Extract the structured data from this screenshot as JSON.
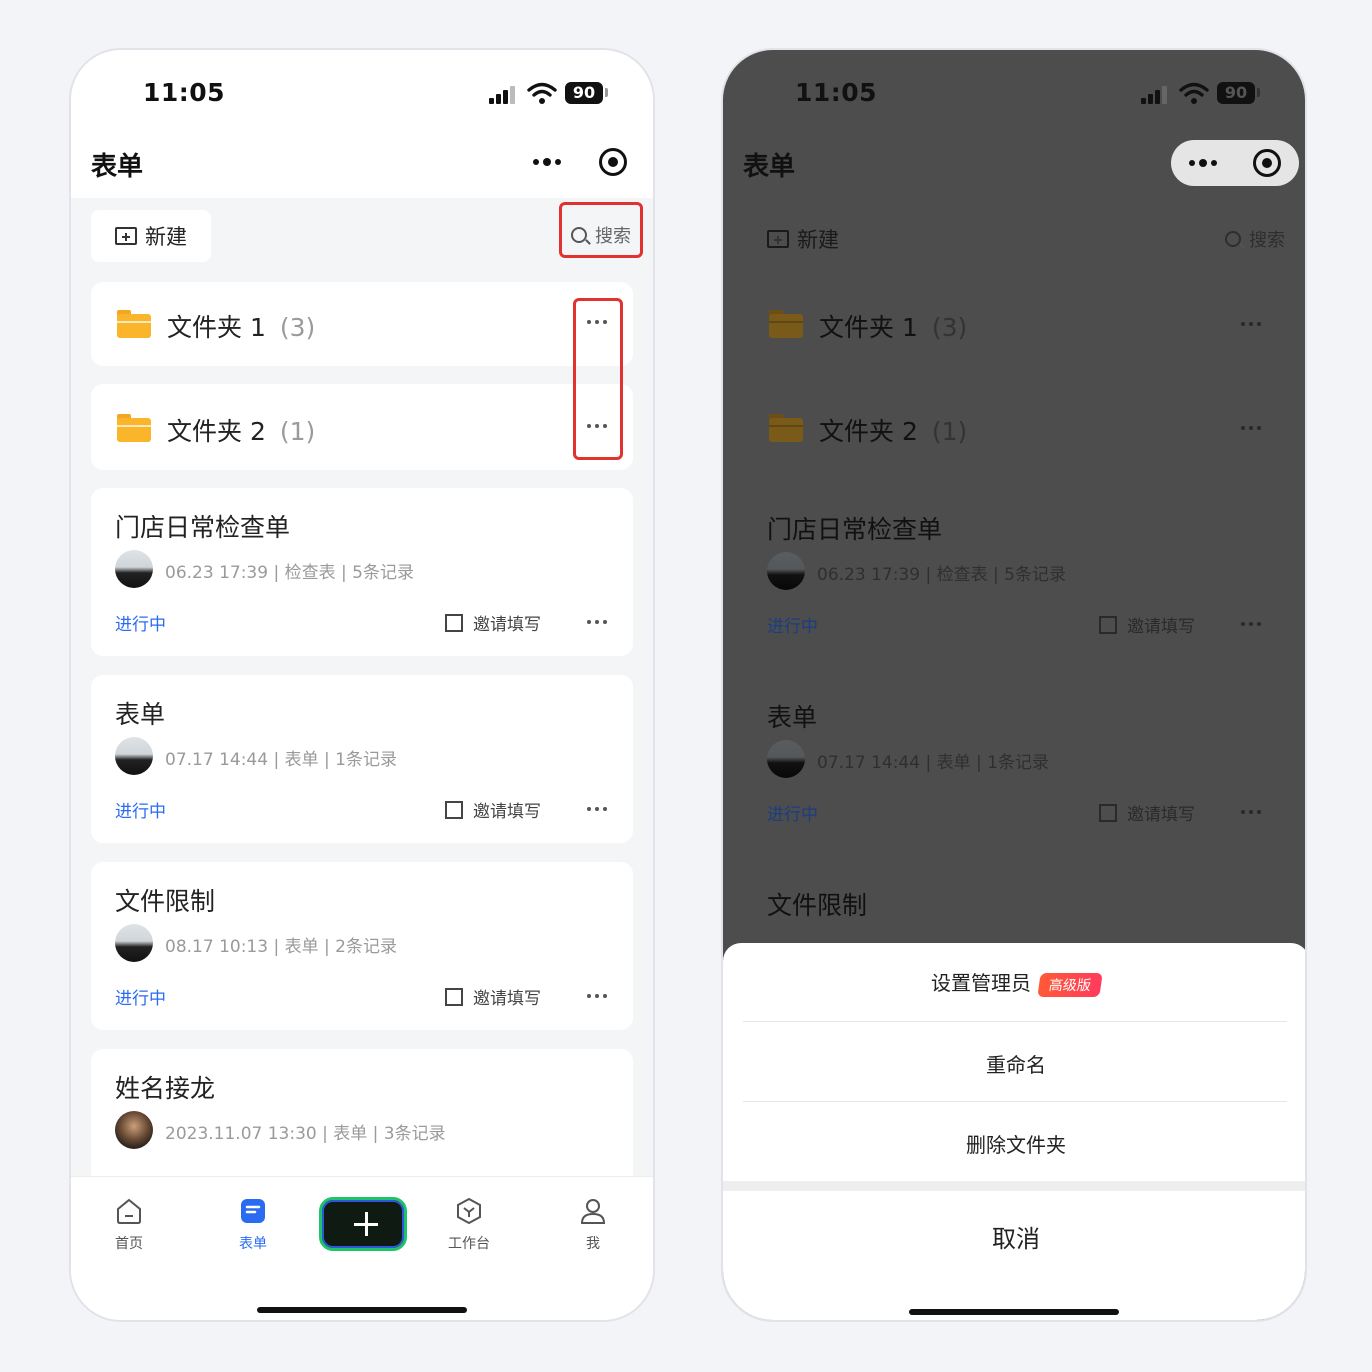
{
  "status_bar": {
    "time": "11:05",
    "battery": "90"
  },
  "nav": {
    "title": "表单"
  },
  "toolbar": {
    "new_label": "新建",
    "search_label": "搜索"
  },
  "folders": [
    {
      "name": "文件夹 1",
      "count": "(3)"
    },
    {
      "name": "文件夹 2",
      "count": "(1)"
    }
  ],
  "forms": [
    {
      "title": "门店日常检查单",
      "meta": "06.23 17:39 | 检查表 | 5条记录",
      "status": "进行中",
      "invite": "邀请填写"
    },
    {
      "title": "表单",
      "meta": "07.17 14:44 | 表单 | 1条记录",
      "status": "进行中",
      "invite": "邀请填写"
    },
    {
      "title": "文件限制",
      "meta": "08.17 10:13 | 表单 | 2条记录",
      "status": "进行中",
      "invite": "邀请填写"
    },
    {
      "title": "姓名接龙",
      "meta": "2023.11.07 13:30 | 表单 | 3条记录"
    }
  ],
  "tabbar": {
    "home": "首页",
    "forms": "表单",
    "workbench": "工作台",
    "me": "我"
  },
  "action_sheet": {
    "set_admin": "设置管理员",
    "badge": "高级版",
    "rename": "重命名",
    "delete": "删除文件夹",
    "cancel": "取消"
  },
  "colors": {
    "accent_blue": "#2a6bf2",
    "folder_yellow": "#fbb52a",
    "highlight_red": "#e0322f",
    "plus_green": "#1fc46a",
    "badge_red": "#ff4a45"
  }
}
